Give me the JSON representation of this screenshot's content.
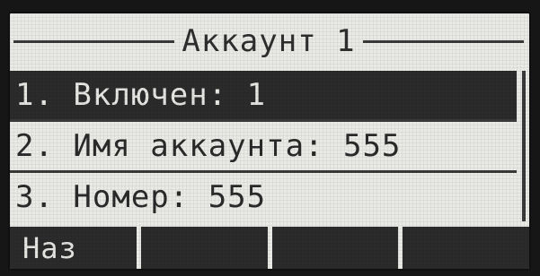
{
  "screen": {
    "title": "Аккаунт 1"
  },
  "menu": {
    "items": [
      {
        "label": "1. Включен: 1",
        "selected": true
      },
      {
        "label": "2. Имя аккаунта: 555",
        "selected": false
      },
      {
        "label": "3. Номер: 555",
        "selected": false
      }
    ]
  },
  "softkeys": [
    {
      "label": "Наз"
    },
    {
      "label": ""
    },
    {
      "label": ""
    },
    {
      "label": ""
    }
  ],
  "colors": {
    "lcd_background": "#e9e9e6",
    "lcd_foreground": "#2b2b2b",
    "bezel": "#161616"
  }
}
